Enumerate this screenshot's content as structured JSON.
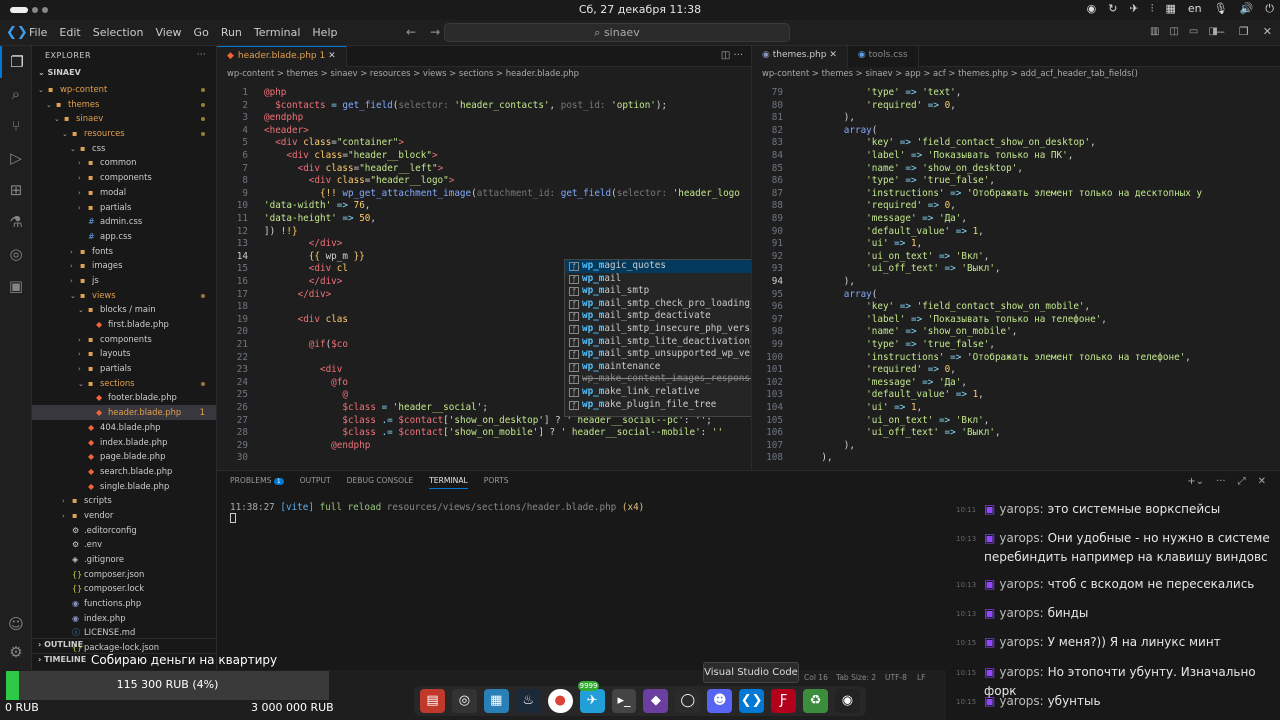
{
  "system": {
    "datetime": "Сб, 27 декабря 11:38",
    "lang": "en"
  },
  "menus": [
    "File",
    "Edit",
    "Selection",
    "View",
    "Go",
    "Run",
    "Terminal",
    "Help"
  ],
  "search": {
    "text": "sinaev"
  },
  "explorer": {
    "header": "EXPLORER",
    "project": "SINAEV",
    "outline": "OUTLINE",
    "timeline": "TIMELINE",
    "items": [
      {
        "label": "wp-content",
        "depth": 1,
        "type": "folder",
        "open": true,
        "dot": true
      },
      {
        "label": "themes",
        "depth": 2,
        "type": "folder",
        "open": true,
        "dot": true
      },
      {
        "label": "sinaev",
        "depth": 3,
        "type": "folder",
        "open": true,
        "dot": true
      },
      {
        "label": "resources",
        "depth": 4,
        "type": "folder",
        "open": true,
        "dot": true
      },
      {
        "label": "css",
        "depth": 5,
        "type": "folder",
        "open": true
      },
      {
        "label": "common",
        "depth": 6,
        "type": "folder"
      },
      {
        "label": "components",
        "depth": 6,
        "type": "folder"
      },
      {
        "label": "modal",
        "depth": 6,
        "type": "folder"
      },
      {
        "label": "partials",
        "depth": 6,
        "type": "folder"
      },
      {
        "label": "admin.css",
        "depth": 6,
        "type": "css"
      },
      {
        "label": "app.css",
        "depth": 6,
        "type": "css"
      },
      {
        "label": "fonts",
        "depth": 5,
        "type": "folder"
      },
      {
        "label": "images",
        "depth": 5,
        "type": "folder"
      },
      {
        "label": "js",
        "depth": 5,
        "type": "folder"
      },
      {
        "label": "views",
        "depth": 5,
        "type": "folder",
        "open": true,
        "dot": true
      },
      {
        "label": "blocks / main",
        "depth": 6,
        "type": "folder",
        "open": true
      },
      {
        "label": "first.blade.php",
        "depth": 7,
        "type": "blade"
      },
      {
        "label": "components",
        "depth": 6,
        "type": "folder"
      },
      {
        "label": "layouts",
        "depth": 6,
        "type": "folder"
      },
      {
        "label": "partials",
        "depth": 6,
        "type": "folder"
      },
      {
        "label": "sections",
        "depth": 6,
        "type": "folder",
        "open": true,
        "dot": true
      },
      {
        "label": "footer.blade.php",
        "depth": 7,
        "type": "blade"
      },
      {
        "label": "header.blade.php",
        "depth": 7,
        "type": "blade",
        "selected": true,
        "badge": "1"
      },
      {
        "label": "404.blade.php",
        "depth": 6,
        "type": "blade"
      },
      {
        "label": "index.blade.php",
        "depth": 6,
        "type": "blade"
      },
      {
        "label": "page.blade.php",
        "depth": 6,
        "type": "blade"
      },
      {
        "label": "search.blade.php",
        "depth": 6,
        "type": "blade"
      },
      {
        "label": "single.blade.php",
        "depth": 6,
        "type": "blade"
      },
      {
        "label": "scripts",
        "depth": 4,
        "type": "folder"
      },
      {
        "label": "vendor",
        "depth": 4,
        "type": "folder"
      },
      {
        "label": ".editorconfig",
        "depth": 4,
        "type": "cfg"
      },
      {
        "label": ".env",
        "depth": 4,
        "type": "cfg"
      },
      {
        "label": ".gitignore",
        "depth": 4,
        "type": "git"
      },
      {
        "label": "composer.json",
        "depth": 4,
        "type": "json"
      },
      {
        "label": "composer.lock",
        "depth": 4,
        "type": "json"
      },
      {
        "label": "functions.php",
        "depth": 4,
        "type": "php"
      },
      {
        "label": "index.php",
        "depth": 4,
        "type": "php"
      },
      {
        "label": "LICENSE.md",
        "depth": 4,
        "type": "md"
      },
      {
        "label": "package-lock.json",
        "depth": 4,
        "type": "json"
      }
    ]
  },
  "editor1": {
    "tab": "header.blade.php",
    "tab_badge": "1",
    "breadcrumb": "wp-content > themes > sinaev > resources > views > sections > header.blade.php",
    "lines": [
      {
        "n": "1",
        "h": "<span class=kw>@php</span>"
      },
      {
        "n": "2",
        "h": "  <span class=vr>$contacts</span> <span class=op>=</span> <span class=fn>get_field</span>(<span class=hint>selector:</span> <span class=str>'header_contacts'</span>, <span class=hint>post_id:</span> <span class=str>'option'</span>);"
      },
      {
        "n": "3",
        "h": "<span class=kw>@endphp</span>"
      },
      {
        "n": "4",
        "h": "<span class=tag>&lt;header&gt;</span>"
      },
      {
        "n": "5",
        "h": "  <span class=tag>&lt;div</span> <span class=at>class</span>=<span class=str>\"container\"</span><span class=tag>&gt;</span>"
      },
      {
        "n": "6",
        "h": "    <span class=tag>&lt;div</span> <span class=at>class</span>=<span class=str>\"header__block\"</span><span class=tag>&gt;</span>"
      },
      {
        "n": "7",
        "h": "      <span class=tag>&lt;div</span> <span class=at>class</span>=<span class=str>\"header__left\"</span><span class=tag>&gt;</span>"
      },
      {
        "n": "8",
        "h": "        <span class=tag>&lt;div</span> <span class=at>class</span>=<span class=str>\"header__logo\"</span><span class=tag>&gt;</span>"
      },
      {
        "n": "9",
        "h": "          <span class=at>{!!</span> <span class=fn>wp_get_attachment_image</span>(<span class=hint>attachment_id:</span> <span class=fn>get_field</span>(<span class=hint>selector:</span> <span class=str>'header_logo</span>"
      },
      {
        "n": "10",
        "h": "<span class=str>'data-width'</span> <span class=op>=&gt;</span> <span class=at>76</span>,"
      },
      {
        "n": "11",
        "h": "<span class=str>'data-height'</span> <span class=op>=&gt;</span> <span class=at>50</span>,"
      },
      {
        "n": "12",
        "h": "]) <span class=at>!!}</span>"
      },
      {
        "n": "13",
        "h": "        <span class=tag>&lt;/div&gt;</span>"
      },
      {
        "n": "14",
        "h": "        <span class=at>{{</span> wp_m <span class=at>}}</span>"
      },
      {
        "n": "15",
        "h": "        <span class=tag>&lt;div</span> <span class=at>cl</span>"
      },
      {
        "n": "16",
        "h": "        <span class=tag>&lt;/div&gt;</span>"
      },
      {
        "n": "17",
        "h": "      <span class=tag>&lt;/div&gt;</span>"
      },
      {
        "n": "18",
        "h": ""
      },
      {
        "n": "19",
        "h": "      <span class=tag>&lt;div</span> <span class=at>clas</span>"
      },
      {
        "n": "20",
        "h": ""
      },
      {
        "n": "21",
        "h": "        <span class=kw>@if</span>(<span class=vr>$co</span>"
      },
      {
        "n": "22",
        "h": ""
      },
      {
        "n": "23",
        "h": "          <span class=tag>&lt;div</span>"
      },
      {
        "n": "24",
        "h": "            <span class=kw>@fo</span>"
      },
      {
        "n": "25",
        "h": "              <span class=kw>@</span>"
      },
      {
        "n": "26",
        "h": "              <span class=vr>$class</span> <span class=op>=</span> <span class=str>'header__social'</span>;"
      },
      {
        "n": "27",
        "h": "              <span class=vr>$class</span> <span class=op>.=</span> <span class=vr>$contact</span>[<span class=str>'show_on_desktop'</span>] ? <span class=str>' header__social--pc'</span>: <span class=str>''</span>;"
      },
      {
        "n": "28",
        "h": "              <span class=vr>$class</span> <span class=op>.=</span> <span class=vr>$contact</span>[<span class=str>'show_on_mobile'</span>] ? <span class=str>' header__social--mobile'</span>: <span class=str>''</span>"
      },
      {
        "n": "29",
        "h": "            <span class=kw>@endphp</span>"
      },
      {
        "n": "30",
        "h": ""
      }
    ],
    "suggestions": [
      {
        "b": "wp_m",
        "r": "agic_quotes",
        "sel": true
      },
      {
        "b": "wp_m",
        "r": "ail"
      },
      {
        "b": "wp_m",
        "r": "ail_smtp"
      },
      {
        "b": "wp_m",
        "r": "ail_smtp_check_pro_loading_allowed"
      },
      {
        "b": "wp_m",
        "r": "ail_smtp_deactivate"
      },
      {
        "b": "wp_m",
        "r": "ail_smtp_insecure_php_version_notice"
      },
      {
        "b": "wp_m",
        "r": "ail_smtp_lite_deactivation_notice"
      },
      {
        "b": "wp_m",
        "r": "ail_smtp_unsupported_wp_version_notice"
      },
      {
        "b": "wp_m",
        "r": "aintenance"
      },
      {
        "b": "",
        "r": "wp_make_content_images_responsive",
        "strike": true
      },
      {
        "b": "wp_m",
        "r": "ake_link_relative"
      },
      {
        "b": "wp_m",
        "r": "ake_plugin_file_tree"
      }
    ]
  },
  "editor2": {
    "tab": "themes.php",
    "tab2": "tools.css",
    "breadcrumb": "wp-content > themes > sinaev > app > acf > themes.php > add_acf_header_tab_fields()",
    "lines": [
      {
        "n": "79",
        "h": "            <span class=str>'type'</span> <span class=op>=&gt;</span> <span class=str>'text'</span>,"
      },
      {
        "n": "80",
        "h": "            <span class=str>'required'</span> <span class=op>=&gt;</span> <span class=at>0</span>,"
      },
      {
        "n": "81",
        "h": "        ),"
      },
      {
        "n": "82",
        "h": "        <span class=fn>array</span>("
      },
      {
        "n": "83",
        "h": "            <span class=str>'key'</span> <span class=op>=&gt;</span> <span class=str>'field_contact_show_on_desktop'</span>,"
      },
      {
        "n": "84",
        "h": "            <span class=str>'label'</span> <span class=op>=&gt;</span> <span class=str>'Показывать только на ПК'</span>,"
      },
      {
        "n": "85",
        "h": "            <span class=str>'name'</span> <span class=op>=&gt;</span> <span class=str>'show_on_desktop'</span>,"
      },
      {
        "n": "86",
        "h": "            <span class=str>'type'</span> <span class=op>=&gt;</span> <span class=str>'true_false'</span>,"
      },
      {
        "n": "87",
        "h": "            <span class=str>'instructions'</span> <span class=op>=&gt;</span> <span class=str>'Отображать элемент только на десктопных у</span>"
      },
      {
        "n": "88",
        "h": "            <span class=str>'required'</span> <span class=op>=&gt;</span> <span class=at>0</span>,"
      },
      {
        "n": "89",
        "h": "            <span class=str>'message'</span> <span class=op>=&gt;</span> <span class=str>'Да'</span>,"
      },
      {
        "n": "90",
        "h": "            <span class=str>'default_value'</span> <span class=op>=&gt;</span> <span class=at>1</span>,"
      },
      {
        "n": "91",
        "h": "            <span class=str>'ui'</span> <span class=op>=&gt;</span> <span class=at>1</span>,"
      },
      {
        "n": "92",
        "h": "            <span class=str>'ui_on_text'</span> <span class=op>=&gt;</span> <span class=str>'Вкл'</span>,"
      },
      {
        "n": "93",
        "h": "            <span class=str>'ui_off_text'</span> <span class=op>=&gt;</span> <span class=str>'Выкл'</span>,"
      },
      {
        "n": "94",
        "h": "        ),"
      },
      {
        "n": "95",
        "h": "        <span class=fn>array</span>("
      },
      {
        "n": "96",
        "h": "            <span class=str>'key'</span> <span class=op>=&gt;</span> <span class=str>'field_contact_show_on_mobile'</span>,"
      },
      {
        "n": "97",
        "h": "            <span class=str>'label'</span> <span class=op>=&gt;</span> <span class=str>'Показывать только на телефоне'</span>,"
      },
      {
        "n": "98",
        "h": "            <span class=str>'name'</span> <span class=op>=&gt;</span> <span class=str>'show_on_mobile'</span>,"
      },
      {
        "n": "99",
        "h": "            <span class=str>'type'</span> <span class=op>=&gt;</span> <span class=str>'true_false'</span>,"
      },
      {
        "n": "100",
        "h": "            <span class=str>'instructions'</span> <span class=op>=&gt;</span> <span class=str>'Отображать элемент только на телефоне'</span>,"
      },
      {
        "n": "101",
        "h": "            <span class=str>'required'</span> <span class=op>=&gt;</span> <span class=at>0</span>,"
      },
      {
        "n": "102",
        "h": "            <span class=str>'message'</span> <span class=op>=&gt;</span> <span class=str>'Да'</span>,"
      },
      {
        "n": "103",
        "h": "            <span class=str>'default_value'</span> <span class=op>=&gt;</span> <span class=at>1</span>,"
      },
      {
        "n": "104",
        "h": "            <span class=str>'ui'</span> <span class=op>=&gt;</span> <span class=at>1</span>,"
      },
      {
        "n": "105",
        "h": "            <span class=str>'ui_on_text'</span> <span class=op>=&gt;</span> <span class=str>'Вкл'</span>,"
      },
      {
        "n": "106",
        "h": "            <span class=str>'ui_off_text'</span> <span class=op>=&gt;</span> <span class=str>'Выкл'</span>,"
      },
      {
        "n": "107",
        "h": "        ),"
      },
      {
        "n": "108",
        "h": "    ),"
      }
    ]
  },
  "panel": {
    "tabs": [
      "PROBLEMS",
      "OUTPUT",
      "DEBUG CONSOLE",
      "TERMINAL",
      "PORTS"
    ],
    "problems_count": "1",
    "term_time": "11:38:27",
    "term_tag": "[vite]",
    "term_msg": "full reload",
    "term_path": "resources/views/sections/header.blade.php",
    "term_count": "(x4)"
  },
  "chat": [
    {
      "time": "10:11",
      "user": "yarops:",
      "text": "это системные воркспейсы"
    },
    {
      "time": "10:13",
      "user": "yarops:",
      "text": "Они удобные - но нужно в системе перебиндить например на клавишу виндовс"
    },
    {
      "time": "10:13",
      "user": "yarops:",
      "text": "чтоб с вскодом не пересекались"
    },
    {
      "time": "10:13",
      "user": "yarops:",
      "text": "бинды"
    },
    {
      "time": "10:15",
      "user": "yarops:",
      "text": "У меня?)) Я на линукс минт"
    },
    {
      "time": "10:15",
      "user": "yarops:",
      "text": "Но этопочти убунту. Изначально форк"
    },
    {
      "time": "10:15",
      "user": "yarops:",
      "text": "убунтыь"
    }
  ],
  "status": {
    "col": "Col 16",
    "tab_size": "Tab Size: 2",
    "enc": "UTF-8",
    "eol": "LF"
  },
  "tooltip": "Visual Studio Code",
  "donation": {
    "title": "Собираю деньги на квартиру",
    "amount": "115 300 RUB (4%)",
    "progress": 0.04,
    "min": "0 RUB",
    "max": "3 000 000 RUB"
  },
  "dock": {
    "badge": "9999"
  }
}
